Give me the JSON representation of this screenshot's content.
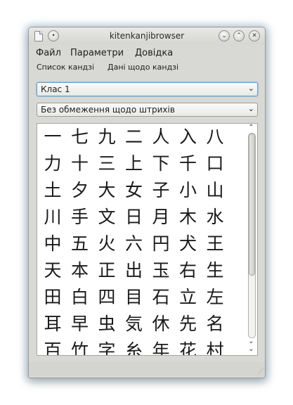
{
  "window": {
    "title": "kitenkanjibrowser"
  },
  "titlebar_buttons": {
    "menu_symbol": "•",
    "minimize_symbol": "⌄",
    "maximize_symbol": "⌃",
    "close_symbol": "✕"
  },
  "menubar": {
    "file_label": "Файл",
    "settings_label": "Параметри",
    "help_label": "Довідка"
  },
  "toolbar": {
    "kanji_list_label": "Список кандзі",
    "kanji_info_label": "Дані щодо кандзі"
  },
  "filters": {
    "grade_selected": "Клас 1",
    "strokes_selected": "Без обмеження щодо штрихів",
    "dropdown_symbol": "⌄"
  },
  "kanji": [
    "一",
    "七",
    "九",
    "二",
    "人",
    "入",
    "八",
    "力",
    "十",
    "三",
    "上",
    "下",
    "千",
    "口",
    "土",
    "夕",
    "大",
    "女",
    "子",
    "小",
    "山",
    "川",
    "手",
    "文",
    "日",
    "月",
    "木",
    "水",
    "中",
    "五",
    "火",
    "六",
    "円",
    "犬",
    "王",
    "天",
    "本",
    "正",
    "出",
    "玉",
    "右",
    "生",
    "田",
    "白",
    "四",
    "目",
    "石",
    "立",
    "左",
    "耳",
    "早",
    "虫",
    "気",
    "休",
    "先",
    "名",
    "百",
    "竹",
    "字",
    "糸",
    "年",
    "花",
    "村"
  ],
  "scrollbar": {
    "up_symbol": "⌃",
    "down_symbol": "⌄",
    "position": 0
  }
}
